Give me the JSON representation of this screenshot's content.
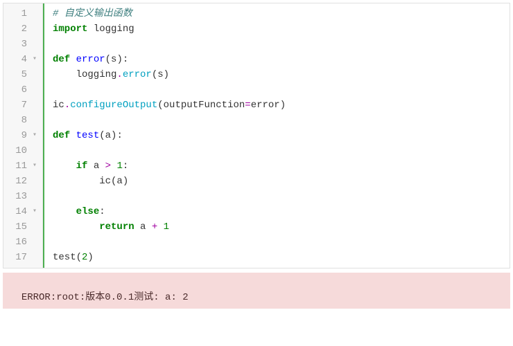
{
  "gutter": [
    {
      "n": "1",
      "fold": ""
    },
    {
      "n": "2",
      "fold": ""
    },
    {
      "n": "3",
      "fold": ""
    },
    {
      "n": "4",
      "fold": "▾"
    },
    {
      "n": "5",
      "fold": ""
    },
    {
      "n": "6",
      "fold": ""
    },
    {
      "n": "7",
      "fold": ""
    },
    {
      "n": "8",
      "fold": ""
    },
    {
      "n": "9",
      "fold": "▾"
    },
    {
      "n": "10",
      "fold": ""
    },
    {
      "n": "11",
      "fold": "▾"
    },
    {
      "n": "12",
      "fold": ""
    },
    {
      "n": "13",
      "fold": ""
    },
    {
      "n": "14",
      "fold": "▾"
    },
    {
      "n": "15",
      "fold": ""
    },
    {
      "n": "16",
      "fold": ""
    },
    {
      "n": "17",
      "fold": ""
    }
  ],
  "code": {
    "l1_comment": "# 自定义输出函数",
    "l2_kw": "import",
    "l2_mod": " logging",
    "l4_kw": "def",
    "l4_fn": " error",
    "l4_sig": "(s):",
    "l5_body": "    logging",
    "l5_dot": ".",
    "l5_call": "error",
    "l5_args": "(s)",
    "l7_obj": "ic",
    "l7_dot": ".",
    "l7_call": "configureOutput",
    "l7_args_open": "(",
    "l7_kwarg": "outputFunction",
    "l7_eq": "=",
    "l7_val": "error",
    "l7_args_close": ")",
    "l9_kw": "def",
    "l9_fn": " test",
    "l9_sig": "(a):",
    "l11_indent": "    ",
    "l11_kw": "if",
    "l11_expr_a": " a ",
    "l11_op": ">",
    "l11_expr_b": " ",
    "l11_num": "1",
    "l11_colon": ":",
    "l12_indent": "        ",
    "l12_call": "ic",
    "l12_args": "(a)",
    "l14_indent": "    ",
    "l14_kw": "else",
    "l14_colon": ":",
    "l15_indent": "        ",
    "l15_kw": "return",
    "l15_expr_a": " a ",
    "l15_op": "+",
    "l15_expr_b": " ",
    "l15_num": "1",
    "l17_call": "test",
    "l17_args_open": "(",
    "l17_num": "2",
    "l17_args_close": ")"
  },
  "output": {
    "error_text": "ERROR:root:版本0.0.1测试: a: 2"
  }
}
